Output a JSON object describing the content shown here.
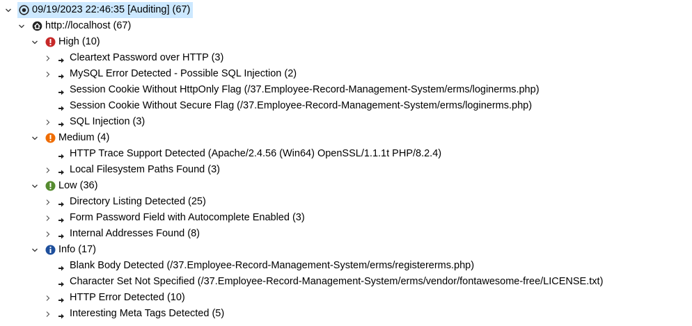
{
  "root": {
    "label": "09/19/2023 22:46:35 [Auditing]  (67)",
    "host": {
      "label": "http://localhost (67)",
      "groups": [
        {
          "severity": "high",
          "color": "#c0392b",
          "label": "High (10)",
          "items": [
            {
              "label": "Cleartext Password over HTTP (3)",
              "expandable": true
            },
            {
              "label": "MySQL Error Detected - Possible SQL Injection (2)",
              "expandable": true
            },
            {
              "label": "Session Cookie Without HttpOnly Flag  (/37.Employee-Record-Management-System/erms/loginerms.php)",
              "expandable": false
            },
            {
              "label": "Session Cookie Without Secure Flag  (/37.Employee-Record-Management-System/erms/loginerms.php)",
              "expandable": false
            },
            {
              "label": "SQL Injection (3)",
              "expandable": true
            }
          ]
        },
        {
          "severity": "medium",
          "color": "#e8731a",
          "label": "Medium (4)",
          "items": [
            {
              "label": "HTTP Trace Support Detected (Apache/2.4.56 (Win64) OpenSSL/1.1.1t PHP/8.2.4)",
              "expandable": false
            },
            {
              "label": "Local Filesystem Paths Found (3)",
              "expandable": true
            }
          ]
        },
        {
          "severity": "low",
          "color": "#5aa02c",
          "label": "Low (36)",
          "items": [
            {
              "label": "Directory Listing Detected (25)",
              "expandable": true
            },
            {
              "label": "Form Password Field with Autocomplete Enabled (3)",
              "expandable": true
            },
            {
              "label": "Internal Addresses Found (8)",
              "expandable": true
            }
          ]
        },
        {
          "severity": "info",
          "color": "#1f4e9e",
          "label": "Info (17)",
          "items": [
            {
              "label": "Blank Body Detected (/37.Employee-Record-Management-System/erms/registererms.php)",
              "expandable": false
            },
            {
              "label": "Character Set Not Specified  (/37.Employee-Record-Management-System/erms/vendor/fontawesome-free/LICENSE.txt)",
              "expandable": false
            },
            {
              "label": "HTTP Error Detected (10)",
              "expandable": true
            },
            {
              "label": "Interesting Meta Tags Detected (5)",
              "expandable": true
            }
          ]
        }
      ]
    }
  }
}
